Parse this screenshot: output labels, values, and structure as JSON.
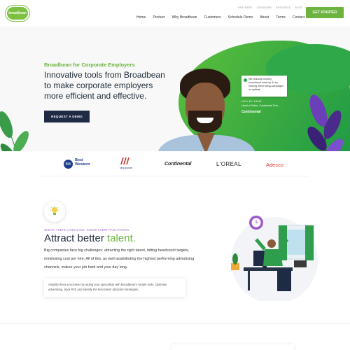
{
  "header": {
    "logo_text": "broadbean",
    "util_nav": [
      "PARTNERS",
      "JOBFINDER",
      "RESOURCE",
      "BLOG"
    ],
    "main_nav": [
      "Home",
      "Product",
      "Why Broadbean",
      "Customers",
      "Schedule Demo",
      "About",
      "Terms",
      "Contact"
    ],
    "cta_label": "GET STARTED"
  },
  "hero": {
    "kicker": "Broadbean for Corporate Employers",
    "title": "Innovative tools from Broadbean to make corporate employers more efficient and effective.",
    "button_label": "REQUEST A DEMO",
    "quote": "We reduced monthly recruitment costs by 3x by running direct hiring campaigns on aptitrak",
    "quote_name": "HAYLEY KANE",
    "quote_role": "Head of Talent, Continental Tires",
    "quote_brand": "Continental"
  },
  "logos": {
    "bw_mark": "BW",
    "bw_text": "Best Western",
    "manpower": "Manpower",
    "continental": "Continental",
    "loreal": "L'OREAL",
    "adecco": "Adecco"
  },
  "attract": {
    "kicker": "SPEAK THEIR LANGUAGE. KNOW THEIR PAIN POINTS",
    "title_main": "Attract better ",
    "title_accent": "talent.",
    "body": "Big companies face big challenges: attracting the right talent, hitting headcount targets, minimising cost per hire. All of this, as well asattributing the highest performing advertising channels, makes your job hard and your day long.",
    "callout": "Simplify these processes by aiding your specialists with Broadbean's simple tools. Optimise advertising, track ROI and identify the best talent attraction strategies."
  },
  "colors": {
    "brand_green": "#6cb33f",
    "navy": "#1f2b44",
    "purple": "#a062c9"
  }
}
